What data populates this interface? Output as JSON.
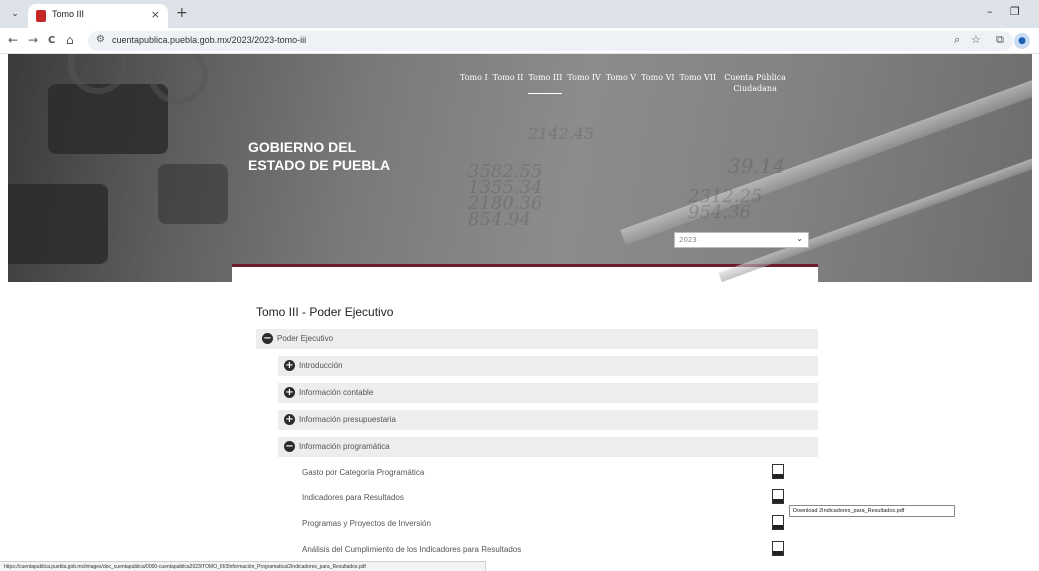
{
  "browser": {
    "tab_title": "Tomo III",
    "url": "cuentapublica.puebla.gob.mx/2023/2023-tomo-iii",
    "tab_close": "×",
    "new_tab": "+",
    "minimize": "–",
    "restore": "❐",
    "back": "←",
    "forward": "→",
    "reload": "C",
    "home": "⌂"
  },
  "hero": {
    "nav": [
      {
        "label": "Tomo I"
      },
      {
        "label": "Tomo II"
      },
      {
        "label": "Tomo III"
      },
      {
        "label": "Tomo IV"
      },
      {
        "label": "Tomo V"
      },
      {
        "label": "Tomo VI"
      },
      {
        "label": "Tomo VII"
      },
      {
        "label": "Cuenta Pública Ciudadana"
      }
    ],
    "brand_line1": "GOBIERNO DEL",
    "brand_line2": "ESTADO DE PUEBLA",
    "year_selected": "2023"
  },
  "content": {
    "title": "Tomo III - Poder Ejecutivo",
    "sections": [
      {
        "label": "Poder Ejecutivo",
        "state": "expanded"
      },
      {
        "label": "Introducción",
        "state": "collapsed"
      },
      {
        "label": "Información contable",
        "state": "collapsed"
      },
      {
        "label": "Información presupuestaria",
        "state": "collapsed"
      },
      {
        "label": "Información programática",
        "state": "expanded"
      }
    ],
    "documents": [
      {
        "label": "Gasto por Categoría Programática"
      },
      {
        "label": "Indicadores para Resultados"
      },
      {
        "label": "Programas y Proyectos de Inversión"
      },
      {
        "label": "Análisis del Cumplimiento de los Indicadores para Resultados"
      }
    ]
  },
  "tooltip": "Download 2Indicadores_para_Resultados.pdf",
  "status_url": "https://cuentapublica.puebla.gob.mx/images/doc_cuentapublica/0000-cuentapublica2023/TOMO_III/3Información_Programatica/2Indicadores_para_Resultados.pdf",
  "colors": {
    "accent": "#6b1d2e"
  }
}
